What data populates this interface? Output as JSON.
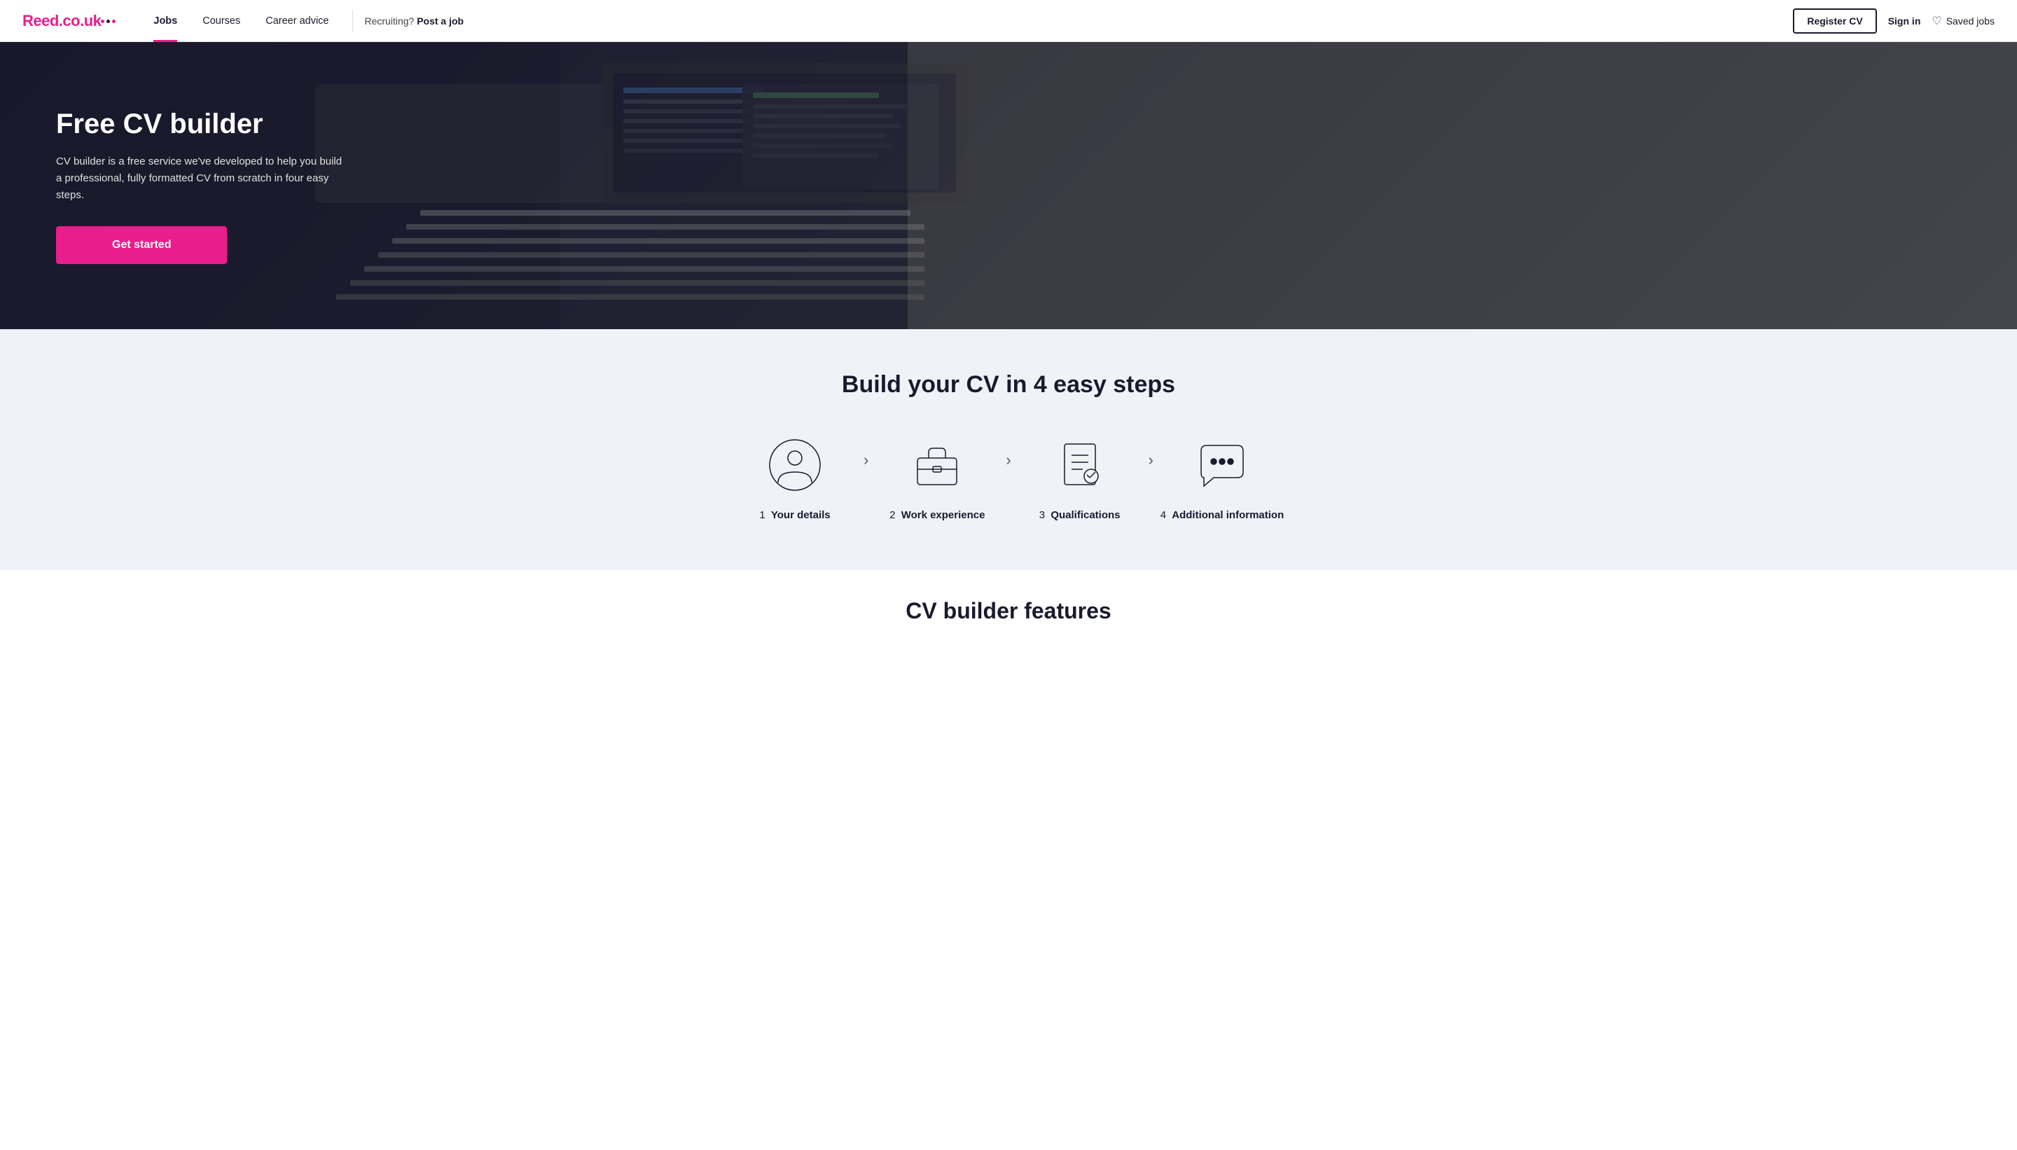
{
  "header": {
    "logo_text": "Reed",
    "logo_tld": ".co.uk",
    "nav_items": [
      {
        "label": "Jobs",
        "active": true
      },
      {
        "label": "Courses",
        "active": false
      },
      {
        "label": "Career advice",
        "active": false
      }
    ],
    "recruiting_text": "Recruiting?",
    "post_job_label": "Post a job",
    "register_label": "Register CV",
    "signin_label": "Sign in",
    "saved_jobs_label": "Saved jobs"
  },
  "hero": {
    "title": "Free CV builder",
    "subtitle": "CV builder is a free service we've developed to help you build a professional, fully formatted CV from scratch in four easy steps.",
    "cta_label": "Get started"
  },
  "steps_section": {
    "title": "Build your CV in 4 easy steps",
    "steps": [
      {
        "number": "1",
        "label": "Your details",
        "icon": "person"
      },
      {
        "number": "2",
        "label": "Work experience",
        "icon": "briefcase"
      },
      {
        "number": "3",
        "label": "Qualifications",
        "icon": "certificate"
      },
      {
        "number": "4",
        "label": "Additional information",
        "icon": "chat"
      }
    ]
  },
  "bottom_teaser": {
    "title": "CV builder features"
  }
}
